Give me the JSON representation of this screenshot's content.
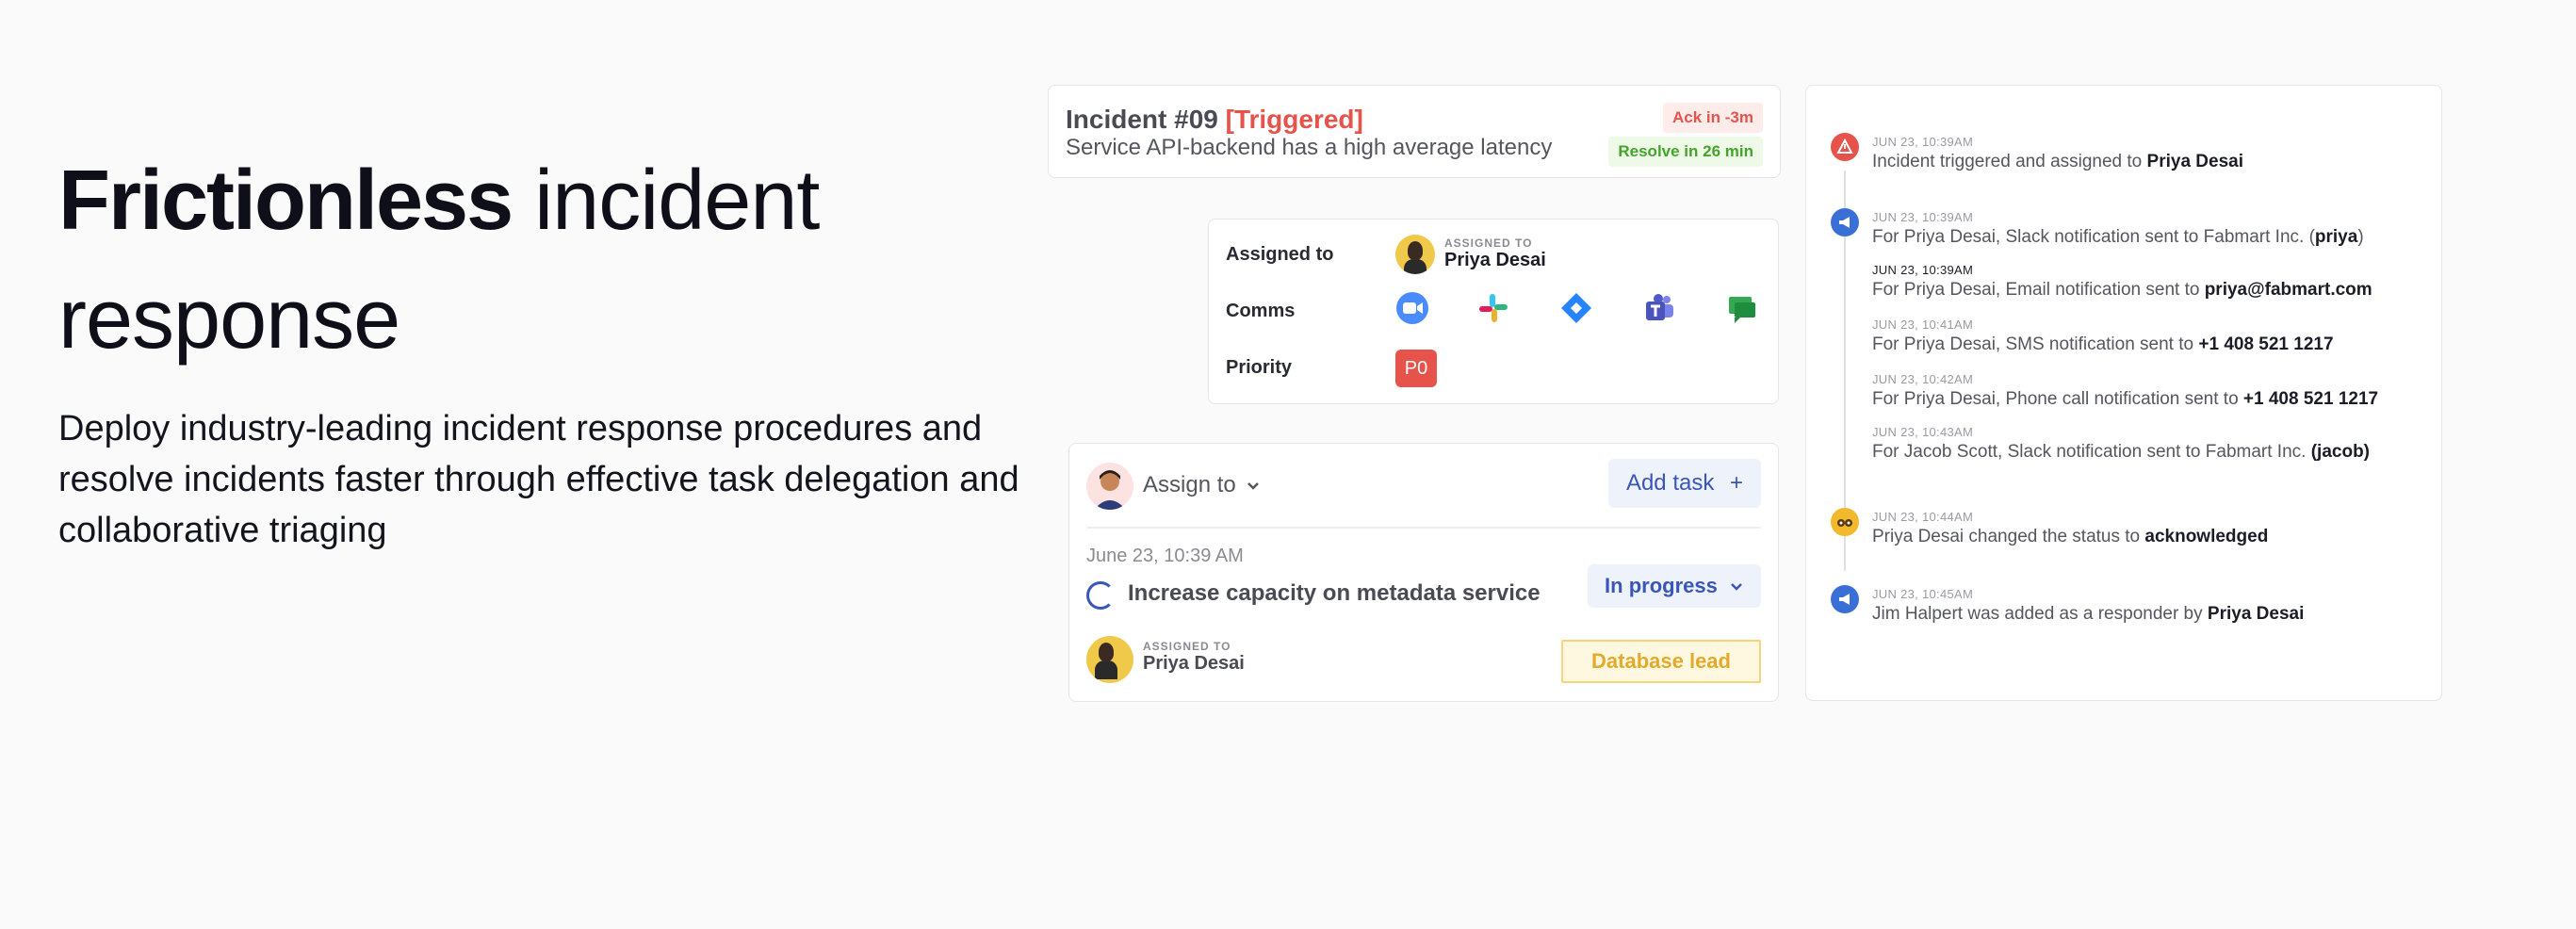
{
  "hero": {
    "title_bold": "Frictionless",
    "title_rest": "incident",
    "title_line2": "response",
    "description": "Deploy industry-leading incident response procedures and resolve incidents faster through effective task delegation and collaborative triaging"
  },
  "incident": {
    "number": "Incident #09",
    "status": "[Triggered]",
    "subtitle": "Service API-backend has a high average latency",
    "ack_badge": "Ack in -3m",
    "resolve_badge": "Resolve in 26 min"
  },
  "details": {
    "assigned_label": "Assigned to",
    "assigned_caption": "ASSIGNED TO",
    "assignee": "Priya Desai",
    "comms_label": "Comms",
    "comms": [
      "zoom-icon",
      "slack-icon",
      "jira-icon",
      "teams-icon",
      "google-chat-icon"
    ],
    "priority_label": "Priority",
    "priority": "P0"
  },
  "task": {
    "assign_to": "Assign to",
    "add_task": "Add task",
    "date": "June 23, 10:39 AM",
    "name": "Increase capacity on metadata service",
    "status": "In progress",
    "assigned_caption": "ASSIGNED TO",
    "assignee": "Priya Desai",
    "role": "Database lead"
  },
  "timeline": {
    "events": [
      {
        "time": "JUN 23, 10:39AM",
        "text": "Incident triggered and assigned to ",
        "bold": "Priya Desai",
        "tail": ""
      },
      {
        "time": "JUN 23, 10:39AM",
        "text": "For Priya Desai, Slack notification sent to Fabmart Inc. (",
        "bold": "priya",
        "tail": ")"
      },
      {
        "time": "JUN 23, 10:39AM",
        "text": "For Priya Desai, Email notification sent to ",
        "bold": "priya@fabmart.com",
        "tail": ""
      },
      {
        "time": "JUN 23, 10:41AM",
        "text": "For Priya Desai, SMS notification sent to ",
        "bold": "+1 408 521 1217",
        "tail": ""
      },
      {
        "time": "JUN 23, 10:42AM",
        "text": "For Priya Desai, Phone call notification sent to ",
        "bold": "+1 408 521 1217",
        "tail": ""
      },
      {
        "time": "JUN 23, 10:43AM",
        "text": "For Jacob Scott, Slack notification sent to Fabmart Inc. ",
        "bold": "(jacob)",
        "tail": ""
      },
      {
        "time": "JUN 23, 10:44AM",
        "text": "Priya Desai changed the status to ",
        "bold": "acknowledged",
        "tail": ""
      },
      {
        "time": "JUN 23, 10:45AM",
        "text": " Jim Halpert was added as a responder by ",
        "bold": "Priya Desai",
        "tail": ""
      }
    ]
  },
  "colors": {
    "triggered": "#e5534b",
    "resolve": "#43a52b",
    "accent_blue": "#3a56b8",
    "lead_yellow": "#e3a92b"
  }
}
